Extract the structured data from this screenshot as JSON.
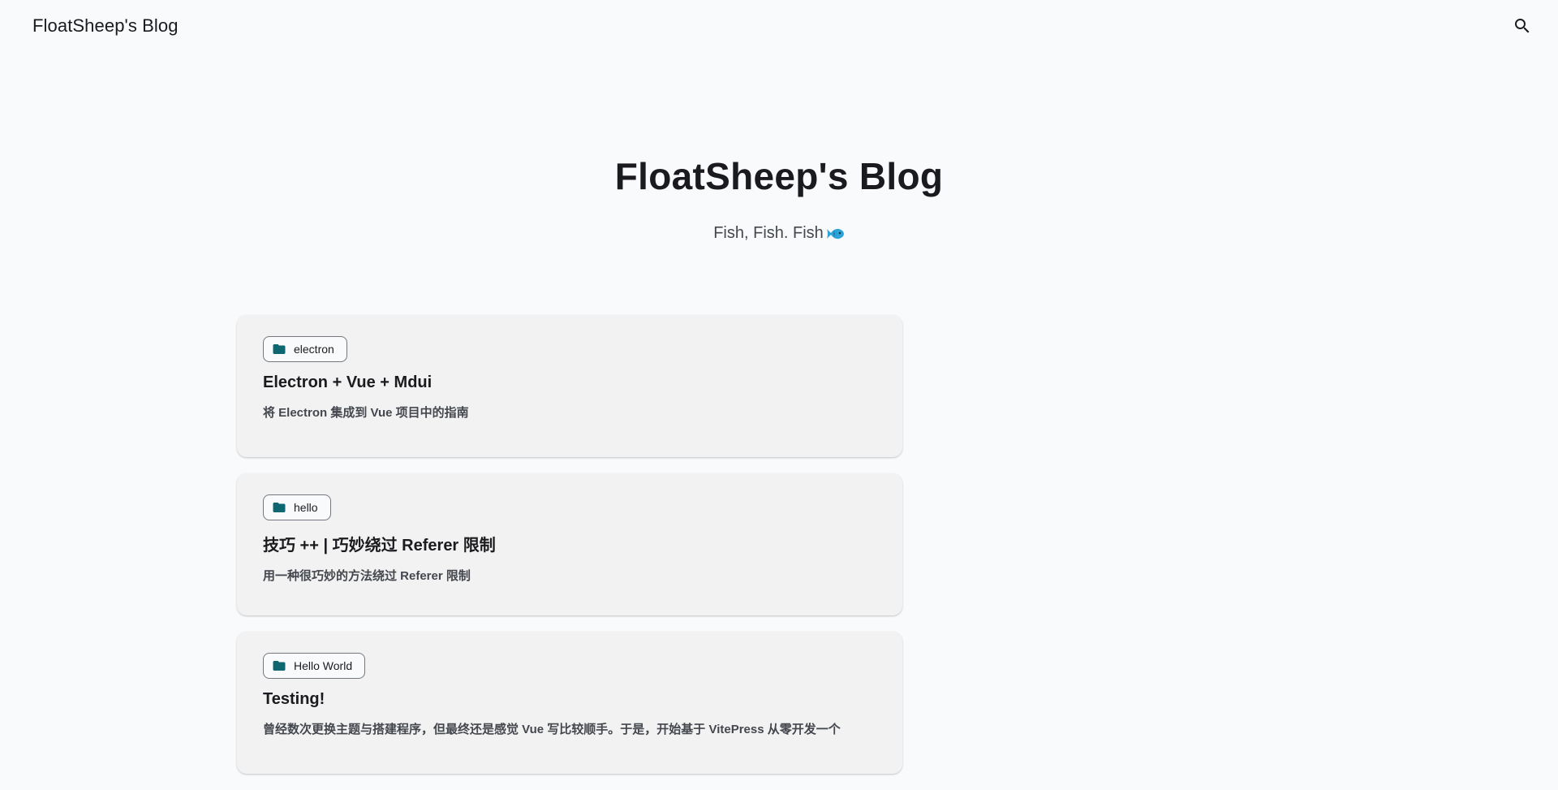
{
  "header": {
    "site_title": "FloatSheep's Blog",
    "search_icon": "search-icon"
  },
  "hero": {
    "title": "FloatSheep's Blog",
    "subtitle": "Fish, Fish. Fish",
    "subtitle_icon": "fish-icon"
  },
  "posts": [
    {
      "category": "electron",
      "category_icon": "folder-icon",
      "title": "Electron + Vue + Mdui",
      "description": "将 Electron 集成到 Vue 项目中的指南"
    },
    {
      "category": "hello",
      "category_icon": "folder-icon",
      "title": "技巧 ++ | 巧妙绕过 Referer 限制",
      "description": "用一种很巧妙的方法绕过 Referer 限制"
    },
    {
      "category": "Hello World",
      "category_icon": "folder-icon",
      "title": "Testing!",
      "description": "曾经数次更换主题与搭建程序，但最终还是感觉 Vue 写比较顺手。于是，开始基于 VitePress 从零开发一个"
    }
  ],
  "colors": {
    "background": "#f9fafc",
    "card": "#f1f2f1",
    "folder_icon": "#0e6670",
    "fish_icon": "#2ea3d8"
  }
}
